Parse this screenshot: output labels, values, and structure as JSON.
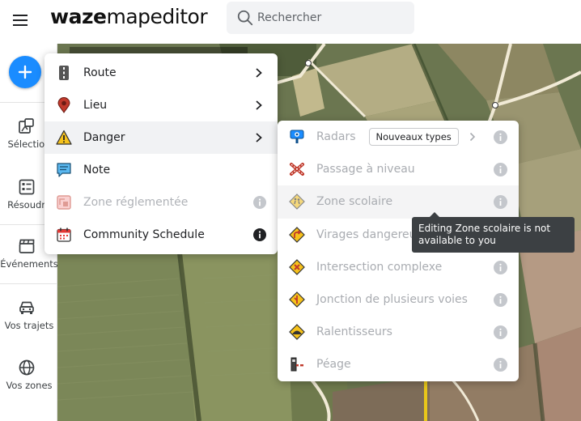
{
  "app": {
    "logo_part1": "waze",
    "logo_part2": "mapeditor"
  },
  "search": {
    "placeholder": "Rechercher"
  },
  "rail": {
    "items": [
      {
        "label": "Sélection"
      },
      {
        "label": "Résoudre"
      },
      {
        "label": "Événements"
      },
      {
        "label": "Vos trajets"
      },
      {
        "label": "Vos zones"
      }
    ]
  },
  "menu": {
    "items": [
      {
        "label": "Route",
        "icon": "road-icon"
      },
      {
        "label": "Lieu",
        "icon": "place-pin-icon"
      },
      {
        "label": "Danger",
        "icon": "warning-icon"
      },
      {
        "label": "Note",
        "icon": "note-icon"
      },
      {
        "label": "Zone réglementée",
        "icon": "restricted-zone-icon"
      },
      {
        "label": "Community Schedule",
        "icon": "calendar-icon"
      }
    ]
  },
  "danger_menu": {
    "items": [
      {
        "label": "Radars",
        "badge": "Nouveaux types",
        "icon": "speed-camera-icon"
      },
      {
        "label": "Passage à niveau",
        "icon": "railroad-crossing-icon"
      },
      {
        "label": "Zone scolaire",
        "icon": "school-zone-icon"
      },
      {
        "label": "Virages dangereux",
        "icon": "sharp-curve-icon"
      },
      {
        "label": "Intersection complexe",
        "icon": "complex-intersection-icon"
      },
      {
        "label": "Jonction de plusieurs voies",
        "icon": "lane-merge-icon"
      },
      {
        "label": "Ralentisseurs",
        "icon": "speed-bump-icon"
      },
      {
        "label": "Péage",
        "icon": "toll-icon"
      }
    ]
  },
  "tooltip": {
    "text": "Editing Zone scolaire is not available to you"
  },
  "colors": {
    "accent": "#1a8cff",
    "warning": "#f6c21b",
    "tooltip_bg": "#3c4043"
  }
}
